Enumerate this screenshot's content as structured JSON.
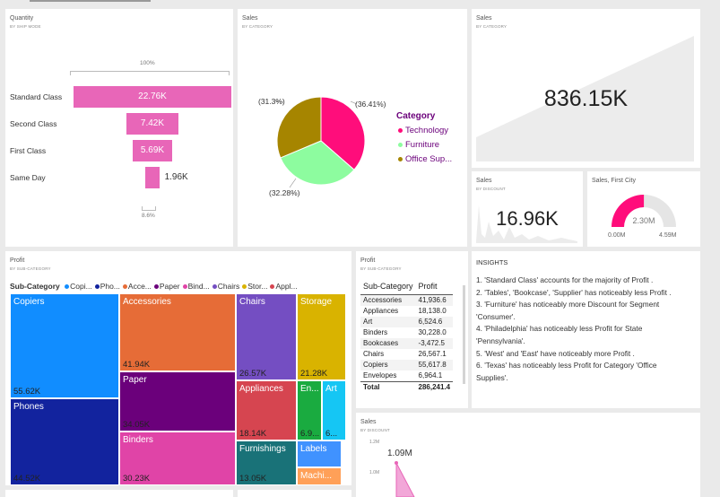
{
  "funnel": {
    "title": "Quantity",
    "subtitle": "BY SHIP MODE",
    "top_pct": "100%",
    "bottom_pct": "8.6%",
    "rows": [
      {
        "label": "Standard Class",
        "value": "22.76K",
        "fraction": 1.0
      },
      {
        "label": "Second Class",
        "value": "7.42K",
        "fraction": 0.326
      },
      {
        "label": "First Class",
        "value": "5.69K",
        "fraction": 0.25
      },
      {
        "label": "Same Day",
        "value": "1.96K",
        "fraction": 0.086
      }
    ]
  },
  "pie": {
    "title": "Sales",
    "subtitle": "BY CATEGORY",
    "legend_title": "Category",
    "slices": [
      {
        "name": "Technology",
        "label": "(36.41%)",
        "value": 36.41,
        "color": "#ff0d7b"
      },
      {
        "name": "Furniture",
        "label": "(32.28%)",
        "value": 32.28,
        "color": "#8dfc9f"
      },
      {
        "name": "Office Sup...",
        "label": "(31.3%)",
        "value": 31.3,
        "color": "#a68500"
      }
    ]
  },
  "area_card": {
    "title": "Sales",
    "subtitle": "BY CATEGORY",
    "value": "836.15K"
  },
  "discount_card": {
    "title": "Sales",
    "subtitle": "BY DISCOUNT",
    "value": "16.96K"
  },
  "gauge": {
    "title": "Sales, First City",
    "value": "2.30M",
    "min": "0.00M",
    "max": "4.59M",
    "fraction": 0.501,
    "color": "#ff0d7b"
  },
  "treemap": {
    "title": "Profit",
    "subtitle": "BY SUB-CATEGORY",
    "legend_title": "Sub-Category",
    "legend": [
      {
        "name": "Copi...",
        "color": "#118dff"
      },
      {
        "name": "Pho...",
        "color": "#12239e"
      },
      {
        "name": "Acce...",
        "color": "#e66c37"
      },
      {
        "name": "Paper",
        "color": "#6b007b"
      },
      {
        "name": "Bind...",
        "color": "#e044a7"
      },
      {
        "name": "Chairs",
        "color": "#744ec2"
      },
      {
        "name": "Stor...",
        "color": "#d9b300"
      },
      {
        "name": "Appl...",
        "color": "#d64550"
      }
    ],
    "cells": [
      {
        "name": "Copiers",
        "value": "55.62K",
        "color": "#118dff"
      },
      {
        "name": "Phones",
        "value": "44.52K",
        "color": "#12239e"
      },
      {
        "name": "Accessories",
        "value": "41.94K",
        "color": "#e66c37"
      },
      {
        "name": "Paper",
        "value": "34.05K",
        "color": "#6b007b"
      },
      {
        "name": "Binders",
        "value": "30.23K",
        "color": "#e044a7"
      },
      {
        "name": "Chairs",
        "value": "26.57K",
        "color": "#744ec2"
      },
      {
        "name": "Storage",
        "value": "21.28K",
        "color": "#d9b300"
      },
      {
        "name": "Appliances",
        "value": "18.14K",
        "color": "#d64550"
      },
      {
        "name": "Furnishings",
        "value": "13.05K",
        "color": "#197278"
      },
      {
        "name": "En...",
        "value": "6.9...",
        "color": "#1aab40"
      },
      {
        "name": "Art",
        "value": "6...",
        "color": "#15c6f4"
      },
      {
        "name": "Labels",
        "value": "",
        "color": "#4092ff"
      },
      {
        "name": "Machi...",
        "value": "",
        "color": "#ffa058"
      }
    ]
  },
  "table": {
    "title": "Profit",
    "subtitle": "BY SUB-CATEGORY",
    "headers": [
      "Sub-Category",
      "Profit"
    ],
    "rows": [
      [
        "Accessories",
        "41,936.6"
      ],
      [
        "Appliances",
        "18,138.0"
      ],
      [
        "Art",
        "6,524.6"
      ],
      [
        "Binders",
        "30,228.0"
      ],
      [
        "Bookcases",
        "-3,472.5"
      ],
      [
        "Chairs",
        "26,567.1"
      ],
      [
        "Copiers",
        "55,617.8"
      ],
      [
        "Envelopes",
        "6,964.1"
      ]
    ],
    "total_label": "Total",
    "total_value": "286,241.4"
  },
  "insights": {
    "title": "INSIGHTS",
    "lines": [
      "1. 'Standard Class' accounts for the majority of Profit .",
      "2. 'Tables', 'Bookcase', 'Supplier' has noticeably less Profit .",
      "3. 'Furniture' has noticeably more Discount for Segment 'Consumer'.",
      "4. 'Philadelphia' has noticeably less Profit for State 'Pennsylvania'.",
      "5. 'West' and 'East' have noticeably more Profit .",
      "6. 'Texas' has noticeably less Profit for Category 'Office Supplies'."
    ]
  },
  "bottom_chart": {
    "title": "Sales",
    "subtitle": "BY DISCOUNT",
    "peak_label": "1.09M",
    "y_ticks": [
      "1.2M",
      "1.0M"
    ]
  }
}
